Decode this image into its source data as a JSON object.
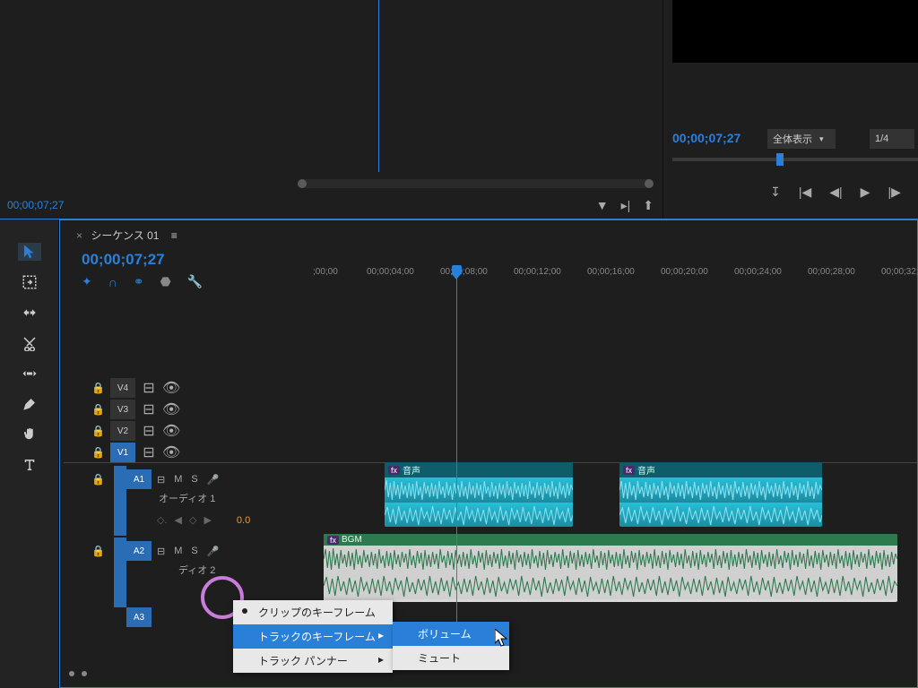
{
  "source": {
    "tc": "00;00;07;27"
  },
  "program": {
    "tc": "00;00;07;27",
    "fit_label": "全体表示",
    "res_label": "1/4"
  },
  "sequence": {
    "tab_label": "シーケンス 01",
    "tc": "00;00;07;27"
  },
  "ruler": [
    ";00;00",
    "00;00;04;00",
    "00;00;08;00",
    "00;00;12;00",
    "00;00;16;00",
    "00;00;20;00",
    "00;00;24;00",
    "00;00;28;00",
    "00;00;32;"
  ],
  "tracks": {
    "v4": "V4",
    "v3": "V3",
    "v2": "V2",
    "v1": "V1",
    "a1": {
      "tag": "A1",
      "name": "オーディオ 1",
      "val": "0.0"
    },
    "a2": {
      "tag": "A2",
      "name": "ディオ 2"
    },
    "a3": {
      "tag": "A3"
    }
  },
  "clips": {
    "audio_label": "音声",
    "bgm_label": "BGM"
  },
  "menu": {
    "clip_kf": "クリップのキーフレーム",
    "track_kf": "トラックのキーフレーム",
    "track_panner": "トラック パンナー",
    "volume": "ボリューム",
    "mute": "ミュート"
  }
}
